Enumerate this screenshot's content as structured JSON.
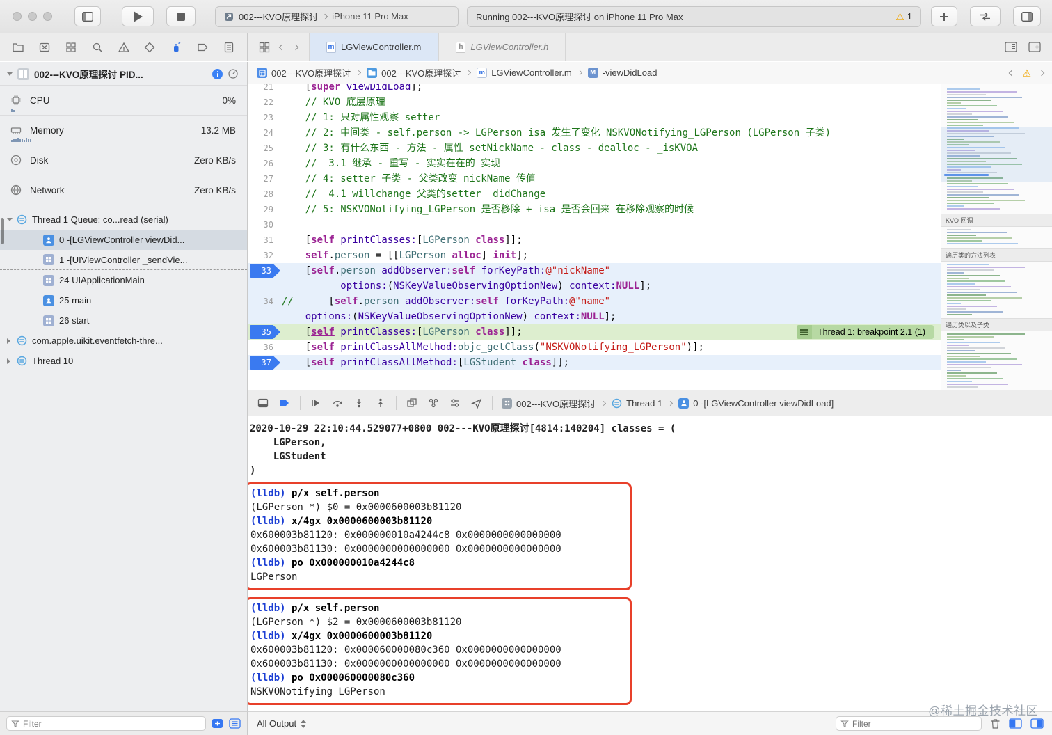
{
  "toolbar": {
    "scheme_project": "002---KVO原理探讨",
    "scheme_device": "iPhone 11 Pro Max",
    "status_text": "Running 002---KVO原理探讨 on iPhone 11 Pro Max",
    "warning_count": "1"
  },
  "tabs": {
    "items": [
      {
        "label": "LGViewController.m",
        "badge": "m",
        "active": true
      },
      {
        "label": "LGViewController.h",
        "badge": "h",
        "active": false
      }
    ]
  },
  "jumpbar": {
    "crumbs": [
      {
        "label": "002---KVO原理探讨",
        "icon": "project"
      },
      {
        "label": "002---KVO原理探讨",
        "icon": "folder"
      },
      {
        "label": "LGViewController.m",
        "icon": "file",
        "badge": "m"
      },
      {
        "label": "-viewDidLoad",
        "icon": "method",
        "badge": "M"
      }
    ]
  },
  "navigator": {
    "process": {
      "title": "002---KVO原理探讨 PID..."
    },
    "gauges": [
      {
        "label": "CPU",
        "value": "0%",
        "icon": "cpu"
      },
      {
        "label": "Memory",
        "value": "13.2 MB",
        "icon": "memory"
      },
      {
        "label": "Disk",
        "value": "Zero KB/s",
        "icon": "disk"
      },
      {
        "label": "Network",
        "value": "Zero KB/s",
        "icon": "network"
      }
    ],
    "threads": [
      {
        "label": "Thread 1 Queue: co...read (serial)",
        "icon": "thread",
        "disclosure": "open",
        "lvl": 0
      },
      {
        "label": "0 -[LGViewController viewDid...",
        "icon": "user",
        "lvl": 1,
        "selected": true
      },
      {
        "label": "1 -[UIViewController _sendVie...",
        "icon": "frame",
        "lvl": 1,
        "dashed": true
      },
      {
        "label": "24 UIApplicationMain",
        "icon": "frame",
        "lvl": 1
      },
      {
        "label": "25 main",
        "icon": "user",
        "lvl": 1
      },
      {
        "label": "26 start",
        "icon": "frame",
        "lvl": 1
      },
      {
        "label": "com.apple.uikit.eventfetch-thre...",
        "icon": "thread",
        "disclosure": "closed",
        "lvl": 0
      },
      {
        "label": "Thread 10",
        "icon": "thread",
        "disclosure": "closed",
        "lvl": 0
      }
    ],
    "filter_placeholder": "Filter"
  },
  "editor": {
    "minimap_sections": [
      "KVO 回调",
      "遍历类的方法列表",
      "遍历类以及子类"
    ],
    "rows": [
      {
        "num": "21",
        "tokens": [
          [
            "pln",
            "    ["
          ],
          [
            "kw",
            "super"
          ],
          [
            "pln",
            " "
          ],
          [
            "mth",
            "viewDidLoad"
          ],
          [
            "pln",
            "];"
          ]
        ]
      },
      {
        "num": "22",
        "tokens": [
          [
            "pln",
            "    "
          ],
          [
            "cm",
            "// KVO 底层原理"
          ]
        ]
      },
      {
        "num": "23",
        "tokens": [
          [
            "pln",
            "    "
          ],
          [
            "cm",
            "// 1: 只对属性观察 setter"
          ]
        ]
      },
      {
        "num": "24",
        "tokens": [
          [
            "pln",
            "    "
          ],
          [
            "cm",
            "// 2: 中间类 - self.person -> LGPerson isa 发生了变化 NSKVONotifying_LGPerson (LGPerson 子类)"
          ]
        ]
      },
      {
        "num": "25",
        "tokens": [
          [
            "pln",
            "    "
          ],
          [
            "cm",
            "// 3: 有什么东西 - 方法 - 属性 setNickName - class - dealloc - _isKVOA"
          ]
        ]
      },
      {
        "num": "26",
        "tokens": [
          [
            "pln",
            "    "
          ],
          [
            "cm",
            "//  3.1 继承 - 重写 - 实实在在的 实现"
          ]
        ]
      },
      {
        "num": "27",
        "tokens": [
          [
            "pln",
            "    "
          ],
          [
            "cm",
            "// 4: setter 子类 - 父类改变 nickName 传值"
          ]
        ]
      },
      {
        "num": "28",
        "tokens": [
          [
            "pln",
            "    "
          ],
          [
            "cm",
            "//  4.1 willchange 父类的setter  didChange"
          ]
        ]
      },
      {
        "num": "29",
        "tokens": [
          [
            "pln",
            "    "
          ],
          [
            "cm",
            "// 5: NSKVONotifying_LGPerson 是否移除 + isa 是否会回来 在移除观察的时候"
          ]
        ]
      },
      {
        "num": "30",
        "tokens": []
      },
      {
        "num": "31",
        "tokens": [
          [
            "pln",
            "    ["
          ],
          [
            "kw",
            "self"
          ],
          [
            "pln",
            " "
          ],
          [
            "mth",
            "printClasses:"
          ],
          [
            "pln",
            "["
          ],
          [
            "cls",
            "LGPerson"
          ],
          [
            "pln",
            " "
          ],
          [
            "kw",
            "class"
          ],
          [
            "pln",
            "]];"
          ]
        ]
      },
      {
        "num": "32",
        "tokens": [
          [
            "pln",
            "    "
          ],
          [
            "kw",
            "self"
          ],
          [
            "pln",
            "."
          ],
          [
            "cls",
            "person"
          ],
          [
            "pln",
            " = [["
          ],
          [
            "cls",
            "LGPerson"
          ],
          [
            "pln",
            " "
          ],
          [
            "kw",
            "alloc"
          ],
          [
            "pln",
            "] "
          ],
          [
            "kw",
            "init"
          ],
          [
            "pln",
            "];"
          ]
        ]
      },
      {
        "num": "33",
        "bp": true,
        "bg": "blue",
        "tokens": [
          [
            "pln",
            "    ["
          ],
          [
            "kw",
            "self"
          ],
          [
            "pln",
            "."
          ],
          [
            "cls",
            "person"
          ],
          [
            "pln",
            " "
          ],
          [
            "mth",
            "addObserver:"
          ],
          [
            "kw",
            "self"
          ],
          [
            "pln",
            " "
          ],
          [
            "mth",
            "forKeyPath:"
          ],
          [
            "str",
            "@\"nickName\""
          ]
        ]
      },
      {
        "num": "",
        "bg": "blue",
        "tokens": [
          [
            "pln",
            "          "
          ],
          [
            "mth",
            "options:"
          ],
          [
            "pln",
            "("
          ],
          [
            "mth",
            "NSKeyValueObservingOptionNew"
          ],
          [
            "pln",
            ") "
          ],
          [
            "mth",
            "context:"
          ],
          [
            "kw",
            "NULL"
          ],
          [
            "pln",
            "];"
          ]
        ]
      },
      {
        "num": "34",
        "bg": "blue",
        "tokens": [
          [
            "cm",
            "//"
          ],
          [
            "pln",
            "      ["
          ],
          [
            "kw",
            "self"
          ],
          [
            "pln",
            "."
          ],
          [
            "cls",
            "person"
          ],
          [
            "pln",
            " "
          ],
          [
            "mth",
            "addObserver:"
          ],
          [
            "kw",
            "self"
          ],
          [
            "pln",
            " "
          ],
          [
            "mth",
            "forKeyPath:"
          ],
          [
            "str",
            "@\"name\""
          ]
        ]
      },
      {
        "num": "",
        "bg": "blue",
        "tokens": [
          [
            "pln",
            "    "
          ],
          [
            "mth",
            "options:"
          ],
          [
            "pln",
            "("
          ],
          [
            "mth",
            "NSKeyValueObservingOptionNew"
          ],
          [
            "pln",
            ") "
          ],
          [
            "mth",
            "context:"
          ],
          [
            "kw",
            "NULL"
          ],
          [
            "pln",
            "];"
          ]
        ]
      },
      {
        "num": "35",
        "bp": true,
        "bg": "green",
        "annotation": "Thread 1: breakpoint 2.1 (1)",
        "tokens": [
          [
            "pln",
            "    ["
          ],
          [
            "kw u",
            "self"
          ],
          [
            "pln",
            " "
          ],
          [
            "mth",
            "printClasses:"
          ],
          [
            "pln",
            "["
          ],
          [
            "cls",
            "LGPerson"
          ],
          [
            "pln",
            " "
          ],
          [
            "kw",
            "class"
          ],
          [
            "pln",
            "]];"
          ]
        ]
      },
      {
        "num": "36",
        "tokens": [
          [
            "pln",
            "    ["
          ],
          [
            "kw",
            "self"
          ],
          [
            "pln",
            " "
          ],
          [
            "mth",
            "printClassAllMethod:"
          ],
          [
            "cls",
            "objc_getClass"
          ],
          [
            "pln",
            "("
          ],
          [
            "str",
            "\"NSKVONotifying_LGPerson\""
          ],
          [
            "pln",
            ")];"
          ]
        ]
      },
      {
        "num": "37",
        "bp": true,
        "bg": "blue",
        "tokens": [
          [
            "pln",
            "    ["
          ],
          [
            "kw",
            "self"
          ],
          [
            "pln",
            " "
          ],
          [
            "mth",
            "printClassAllMethod:"
          ],
          [
            "pln",
            "["
          ],
          [
            "cls",
            "LGStudent"
          ],
          [
            "pln",
            " "
          ],
          [
            "kw",
            "class"
          ],
          [
            "pln",
            "]];"
          ]
        ]
      }
    ]
  },
  "debugbar": {
    "crumbs": [
      {
        "label": "002---KVO原理探讨",
        "icon": "app"
      },
      {
        "label": "Thread 1",
        "icon": "thread"
      },
      {
        "label": "0 -[LGViewController viewDidLoad]",
        "icon": "user"
      }
    ]
  },
  "console": {
    "prompt": "(lldb)",
    "head": [
      "2020-10-29 22:10:44.529077+0800 002---KVO原理探讨[4814:140204] classes = (",
      "    LGPerson,",
      "    LGStudent",
      ")"
    ],
    "blocks": [
      {
        "lines": [
          {
            "k": "cmd",
            "t": "p/x self.person"
          },
          {
            "k": "out",
            "t": "(LGPerson *) $0 = 0x0000600003b81120"
          },
          {
            "k": "cmd",
            "t": "x/4gx 0x0000600003b81120"
          },
          {
            "k": "out",
            "t": "0x600003b81120: 0x000000010a4244c8 0x0000000000000000"
          },
          {
            "k": "out",
            "t": "0x600003b81130: 0x0000000000000000 0x0000000000000000"
          },
          {
            "k": "cmd",
            "t": "po 0x000000010a4244c8"
          },
          {
            "k": "out",
            "t": "LGPerson"
          }
        ]
      },
      {
        "lines": [
          {
            "k": "cmd",
            "t": "p/x self.person"
          },
          {
            "k": "out",
            "t": "(LGPerson *) $2 = 0x0000600003b81120"
          },
          {
            "k": "cmd",
            "t": "x/4gx 0x0000600003b81120"
          },
          {
            "k": "out",
            "t": "0x600003b81120: 0x000060000080c360 0x0000000000000000"
          },
          {
            "k": "out",
            "t": "0x600003b81130: 0x0000000000000000 0x0000000000000000"
          },
          {
            "k": "cmd",
            "t": "po 0x000060000080c360"
          },
          {
            "k": "out",
            "t": "NSKVONotifying_LGPerson"
          }
        ]
      }
    ],
    "all_output_label": "All Output",
    "filter_placeholder": "Filter"
  },
  "watermark": "@稀土掘金技术社区"
}
